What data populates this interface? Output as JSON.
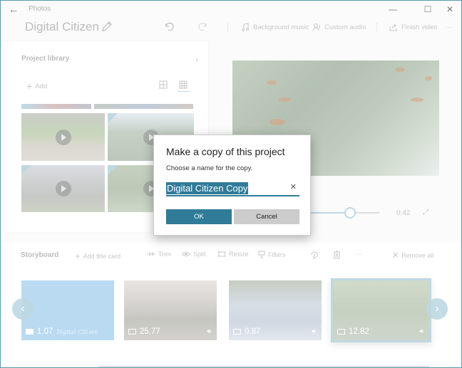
{
  "titlebar": {
    "app_name": "Photos",
    "back_label": "←",
    "minimize": "—",
    "maximize": "☐",
    "close": "✕"
  },
  "toolbar": {
    "project_title": "Digital Citizen",
    "background_music": "Background music",
    "custom_audio": "Custom audio",
    "finish_video": "Finish video",
    "more": "···"
  },
  "library": {
    "title": "Project library",
    "add_label": "Add",
    "collapse": "‹"
  },
  "preview": {
    "time": "0:42",
    "progress": 0.45
  },
  "storyboard": {
    "title": "Storyboard",
    "add_title_card": "Add title card",
    "trim": "Trim",
    "split": "Split",
    "resize": "Resize",
    "filters": "Filters",
    "more": "···",
    "remove_all": "Remove all",
    "prev": "‹",
    "next": "›",
    "clips": [
      {
        "duration": "1.07",
        "type": "title-card",
        "caption": "Digital Citizen",
        "selected": false
      },
      {
        "duration": "25.77",
        "type": "video",
        "audio": true,
        "selected": false
      },
      {
        "duration": "0.87",
        "type": "video",
        "audio": true,
        "selected": false
      },
      {
        "duration": "12.82",
        "type": "video",
        "audio": true,
        "selected": true
      }
    ]
  },
  "dialog": {
    "title": "Make a copy of this project",
    "subtitle": "Choose a name for the copy.",
    "input_value": "Digital Citizen Copy",
    "clear": "✕",
    "ok": "OK",
    "cancel": "Cancel"
  },
  "colors": {
    "accent": "#2f7b98",
    "accent_light": "#9cc4d3",
    "cancel_bg": "#cccccc"
  }
}
